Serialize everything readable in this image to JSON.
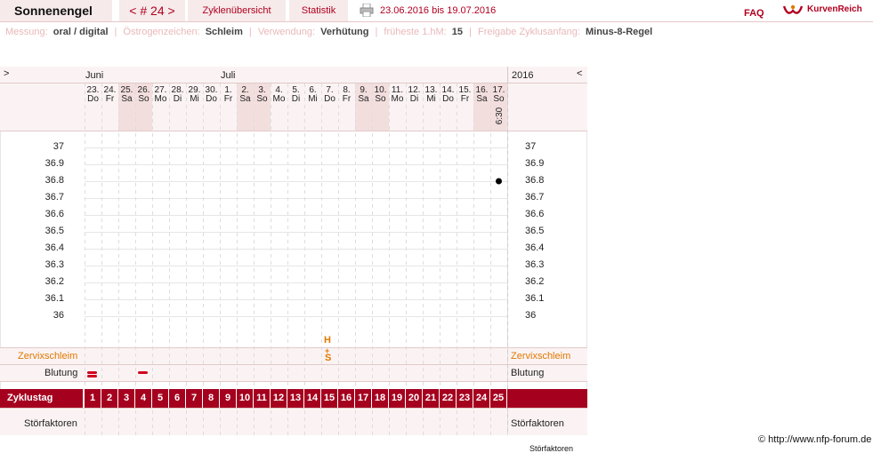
{
  "header": {
    "user": "Sonnenengel",
    "cycle": "< # 24 >",
    "tab_overview": "Zyklenübersicht",
    "tab_stats": "Statistik",
    "date_range": "23.06.2016 bis 19.07.2016",
    "faq": "FAQ",
    "brand": "KurvenReich"
  },
  "info": {
    "messung_label": "Messung:",
    "messung_value": "oral / digital",
    "oestro_label": "Östrogenzeichen:",
    "oestro_value": "Schleim",
    "verwendung_label": "Verwendung:",
    "verwendung_value": "Verhütung",
    "hm_label": "früheste 1.hM:",
    "hm_value": "15",
    "freigabe_label": "Freigabe Zyklusanfang:",
    "freigabe_value": "Minus-8-Regel"
  },
  "chart": {
    "nav_prev": ">",
    "nav_next": "<",
    "month_june": "Juni",
    "month_july": "Juli",
    "year": "2016",
    "days": [
      {
        "d": "23.",
        "w": "Do",
        "we": false
      },
      {
        "d": "24.",
        "w": "Fr",
        "we": false
      },
      {
        "d": "25.",
        "w": "Sa",
        "we": true
      },
      {
        "d": "26.",
        "w": "So",
        "we": true
      },
      {
        "d": "27.",
        "w": "Mo",
        "we": false
      },
      {
        "d": "28.",
        "w": "Di",
        "we": false
      },
      {
        "d": "29.",
        "w": "Mi",
        "we": false
      },
      {
        "d": "30.",
        "w": "Do",
        "we": false
      },
      {
        "d": "1.",
        "w": "Fr",
        "we": false
      },
      {
        "d": "2.",
        "w": "Sa",
        "we": true
      },
      {
        "d": "3.",
        "w": "So",
        "we": true
      },
      {
        "d": "4.",
        "w": "Mo",
        "we": false
      },
      {
        "d": "5.",
        "w": "Di",
        "we": false
      },
      {
        "d": "6.",
        "w": "Mi",
        "we": false
      },
      {
        "d": "7.",
        "w": "Do",
        "we": false
      },
      {
        "d": "8.",
        "w": "Fr",
        "we": false
      },
      {
        "d": "9.",
        "w": "Sa",
        "we": true
      },
      {
        "d": "10.",
        "w": "So",
        "we": true
      },
      {
        "d": "11.",
        "w": "Mo",
        "we": false
      },
      {
        "d": "12.",
        "w": "Di",
        "we": false
      },
      {
        "d": "13.",
        "w": "Mi",
        "we": false
      },
      {
        "d": "14.",
        "w": "Do",
        "we": false
      },
      {
        "d": "15.",
        "w": "Fr",
        "we": false
      },
      {
        "d": "16.",
        "w": "Sa",
        "we": true
      },
      {
        "d": "17.",
        "w": "So",
        "we": true
      }
    ],
    "time_last": "6:30",
    "yticks": [
      "37",
      "36.9",
      "36.8",
      "36.7",
      "36.6",
      "36.5",
      "36.4",
      "36.3",
      "36.2",
      "36.1",
      "36"
    ],
    "row_zervix": "Zervixschleim",
    "row_blutung": "Blutung",
    "row_zyklustag": "Zyklustag",
    "row_stoer": "Störfaktoren",
    "cut_text": "Störfaktoren",
    "mucus_marks": [
      "H",
      "S"
    ],
    "copyright": "© http://www.nfp-forum.de",
    "colors": {
      "accent": "#a5001e",
      "orange": "#e07800",
      "weekend": "#f3dede"
    }
  },
  "chart_data": {
    "type": "scatter",
    "x": [
      "17."
    ],
    "y": [
      36.8
    ],
    "ylim": [
      36,
      37
    ],
    "ylabel": "",
    "xlabel": ""
  }
}
